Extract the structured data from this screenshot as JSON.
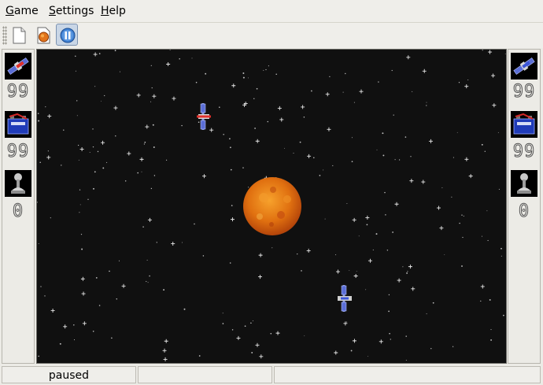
{
  "menubar": {
    "items": [
      {
        "mnemonic": "G",
        "rest": "ame"
      },
      {
        "mnemonic": "S",
        "rest": "ettings"
      },
      {
        "mnemonic": "H",
        "rest": "elp"
      }
    ]
  },
  "toolbar": {
    "buttons": [
      {
        "icon": "new-document-icon",
        "state": "normal"
      },
      {
        "icon": "highscore-icon",
        "state": "normal"
      },
      {
        "icon": "pause-icon",
        "state": "pressed"
      }
    ]
  },
  "player_left": {
    "ship_icon": "red-satellite-icon",
    "energy_icon": "battery-icon",
    "wins_icon": "trophy-icon",
    "hit_points": "99",
    "energy": "99",
    "wins": "0"
  },
  "player_right": {
    "ship_icon": "blue-satellite-icon",
    "energy_icon": "battery-icon",
    "wins_icon": "trophy-icon",
    "hit_points": "99",
    "energy": "99",
    "wins": "0"
  },
  "game_field": {
    "sun_icon": "sun-icon",
    "ships": [
      "red-satellite-icon",
      "blue-satellite-icon"
    ]
  },
  "statusbar": {
    "cells": [
      "paused",
      "",
      ""
    ]
  },
  "colors": {
    "space": "#101010",
    "sun": "#e07a10",
    "chrome": "#ecebe6"
  }
}
